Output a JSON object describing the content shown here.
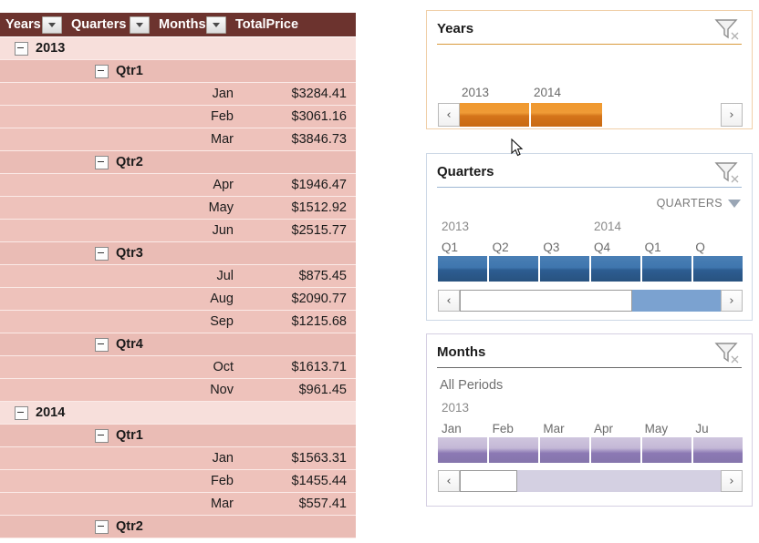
{
  "pivot": {
    "columns": [
      {
        "label": "Years",
        "filter_icon": "filter-dropdown-icon"
      },
      {
        "label": "Quarters",
        "filter_icon": "filter-dropdown-icon"
      },
      {
        "label": "Months",
        "filter_icon": "filter-dropdown-icon"
      },
      {
        "label": "TotalPrice",
        "filter_icon": null
      }
    ],
    "rows": [
      {
        "type": "year",
        "expander": "collapse-minus-icon",
        "year": "2013",
        "quarter": "",
        "month": "",
        "total": ""
      },
      {
        "type": "quarter",
        "expander": "collapse-minus-icon",
        "year": "",
        "quarter": "Qtr1",
        "month": "",
        "total": ""
      },
      {
        "type": "month",
        "expander": null,
        "year": "",
        "quarter": "",
        "month": "Jan",
        "total": "$3284.41"
      },
      {
        "type": "month",
        "expander": null,
        "year": "",
        "quarter": "",
        "month": "Feb",
        "total": "$3061.16"
      },
      {
        "type": "month",
        "expander": null,
        "year": "",
        "quarter": "",
        "month": "Mar",
        "total": "$3846.73"
      },
      {
        "type": "quarter",
        "expander": "collapse-minus-icon",
        "year": "",
        "quarter": "Qtr2",
        "month": "",
        "total": ""
      },
      {
        "type": "month",
        "expander": null,
        "year": "",
        "quarter": "",
        "month": "Apr",
        "total": "$1946.47"
      },
      {
        "type": "month",
        "expander": null,
        "year": "",
        "quarter": "",
        "month": "May",
        "total": "$1512.92"
      },
      {
        "type": "month",
        "expander": null,
        "year": "",
        "quarter": "",
        "month": "Jun",
        "total": "$2515.77"
      },
      {
        "type": "quarter",
        "expander": "collapse-minus-icon",
        "year": "",
        "quarter": "Qtr3",
        "month": "",
        "total": ""
      },
      {
        "type": "month",
        "expander": null,
        "year": "",
        "quarter": "",
        "month": "Jul",
        "total": "$875.45"
      },
      {
        "type": "month",
        "expander": null,
        "year": "",
        "quarter": "",
        "month": "Aug",
        "total": "$2090.77"
      },
      {
        "type": "month",
        "expander": null,
        "year": "",
        "quarter": "",
        "month": "Sep",
        "total": "$1215.68"
      },
      {
        "type": "quarter",
        "expander": "collapse-minus-icon",
        "year": "",
        "quarter": "Qtr4",
        "month": "",
        "total": ""
      },
      {
        "type": "month",
        "expander": null,
        "year": "",
        "quarter": "",
        "month": "Oct",
        "total": "$1613.71"
      },
      {
        "type": "month",
        "expander": null,
        "year": "",
        "quarter": "",
        "month": "Nov",
        "total": "$961.45"
      },
      {
        "type": "year",
        "expander": "collapse-minus-icon",
        "year": "2014",
        "quarter": "",
        "month": "",
        "total": ""
      },
      {
        "type": "quarter",
        "expander": "collapse-minus-icon",
        "year": "",
        "quarter": "Qtr1",
        "month": "",
        "total": ""
      },
      {
        "type": "month",
        "expander": null,
        "year": "",
        "quarter": "",
        "month": "Jan",
        "total": "$1563.31"
      },
      {
        "type": "month",
        "expander": null,
        "year": "",
        "quarter": "",
        "month": "Feb",
        "total": "$1455.44"
      },
      {
        "type": "month",
        "expander": null,
        "year": "",
        "quarter": "",
        "month": "Mar",
        "total": "$557.41"
      },
      {
        "type": "quarter",
        "expander": "collapse-minus-icon",
        "year": "",
        "quarter": "Qtr2",
        "month": "",
        "total": ""
      }
    ]
  },
  "slicers": {
    "years": {
      "title": "Years",
      "filter_icon": "clear-filter-funnel-icon",
      "accent": "#d4741a",
      "level_label": null,
      "selection_caption": null,
      "year_labels": [],
      "tick_labels": [
        "2013",
        "2014"
      ],
      "bars": 2,
      "scroll_prev": "‹",
      "scroll_next": "›"
    },
    "quarters": {
      "title": "Quarters",
      "filter_icon": "clear-filter-funnel-icon",
      "accent": "#2d5d92",
      "level_label": "QUARTERS",
      "level_icon": "chevron-down-icon",
      "selection_caption": null,
      "year_labels": [
        "2013",
        "2014"
      ],
      "tick_labels": [
        "Q1",
        "Q2",
        "Q3",
        "Q4",
        "Q1",
        "Q"
      ],
      "bars": 6,
      "scroll_prev": "‹",
      "scroll_next": "›"
    },
    "months": {
      "title": "Months",
      "filter_icon": "clear-filter-funnel-icon",
      "accent": "#8575ac",
      "level_label": null,
      "selection_caption": "All Periods",
      "year_labels": [
        "2013"
      ],
      "tick_labels": [
        "Jan",
        "Feb",
        "Mar",
        "Apr",
        "May",
        "Ju"
      ],
      "bars": 6,
      "scroll_prev": "‹",
      "scroll_next": "›"
    }
  }
}
